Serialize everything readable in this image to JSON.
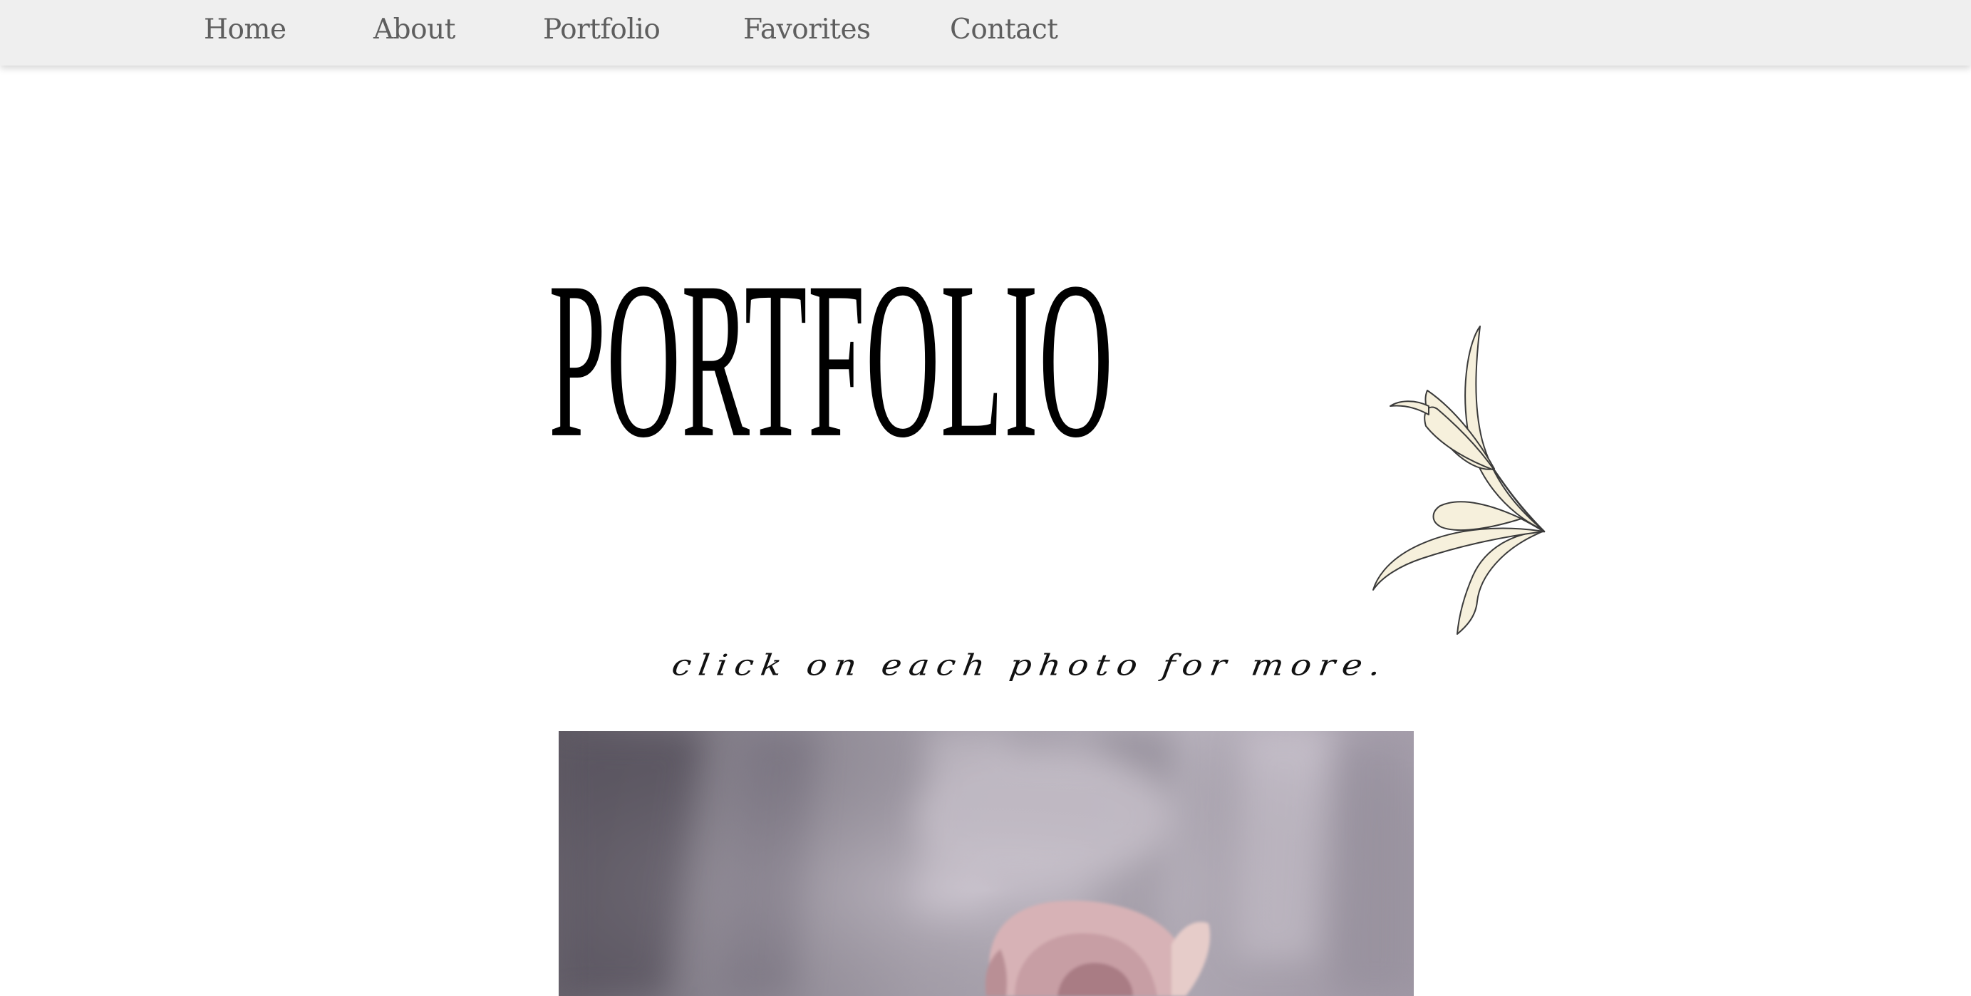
{
  "nav": {
    "items": [
      {
        "label": "Home"
      },
      {
        "label": "About"
      },
      {
        "label": "Portfolio"
      },
      {
        "label": "Favorites"
      },
      {
        "label": "Contact"
      }
    ]
  },
  "hero": {
    "title": "PORTFOLIO",
    "subtitle": "click on each photo for more.",
    "illustration": "lily-line-art"
  },
  "gallery": {
    "photos": [
      {
        "subject": "pink-rose-photo"
      }
    ]
  },
  "colors": {
    "nav_background": "#efefef",
    "nav_text": "#5e5e5e",
    "title_text": "#000000",
    "lily_fill": "#f6f0dc",
    "lily_stroke": "#3a3a3a",
    "rose": "#d9b5b8"
  }
}
